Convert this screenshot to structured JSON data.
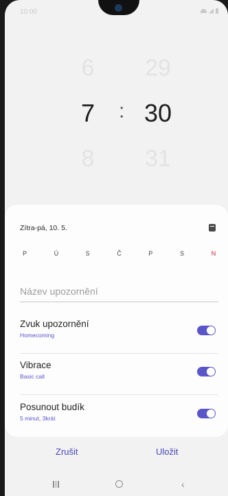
{
  "status_bar": {
    "time": "10:00"
  },
  "picker": {
    "hours": {
      "prev": "6",
      "current": "7",
      "next": "8"
    },
    "minutes": {
      "prev": "29",
      "current": "30",
      "next": "31"
    },
    "separator": ":"
  },
  "schedule": {
    "date_label": "Zítra-pá, 10. 5.",
    "days": [
      "P",
      "Ú",
      "S",
      "Č",
      "P",
      "S",
      "N"
    ]
  },
  "alarm_name": {
    "placeholder": "Název upozornění"
  },
  "settings": [
    {
      "title": "Zvuk upozornění",
      "subtitle": "Homecoming",
      "enabled": true
    },
    {
      "title": "Vibrace",
      "subtitle": "Basic call",
      "enabled": true
    },
    {
      "title": "Posunout budík",
      "subtitle": "5 minut, 3krát",
      "enabled": true
    }
  ],
  "actions": {
    "cancel": "Zrušit",
    "save": "Uložit"
  },
  "colors": {
    "accent": "#5a55c8",
    "sunday": "#d0233e"
  }
}
